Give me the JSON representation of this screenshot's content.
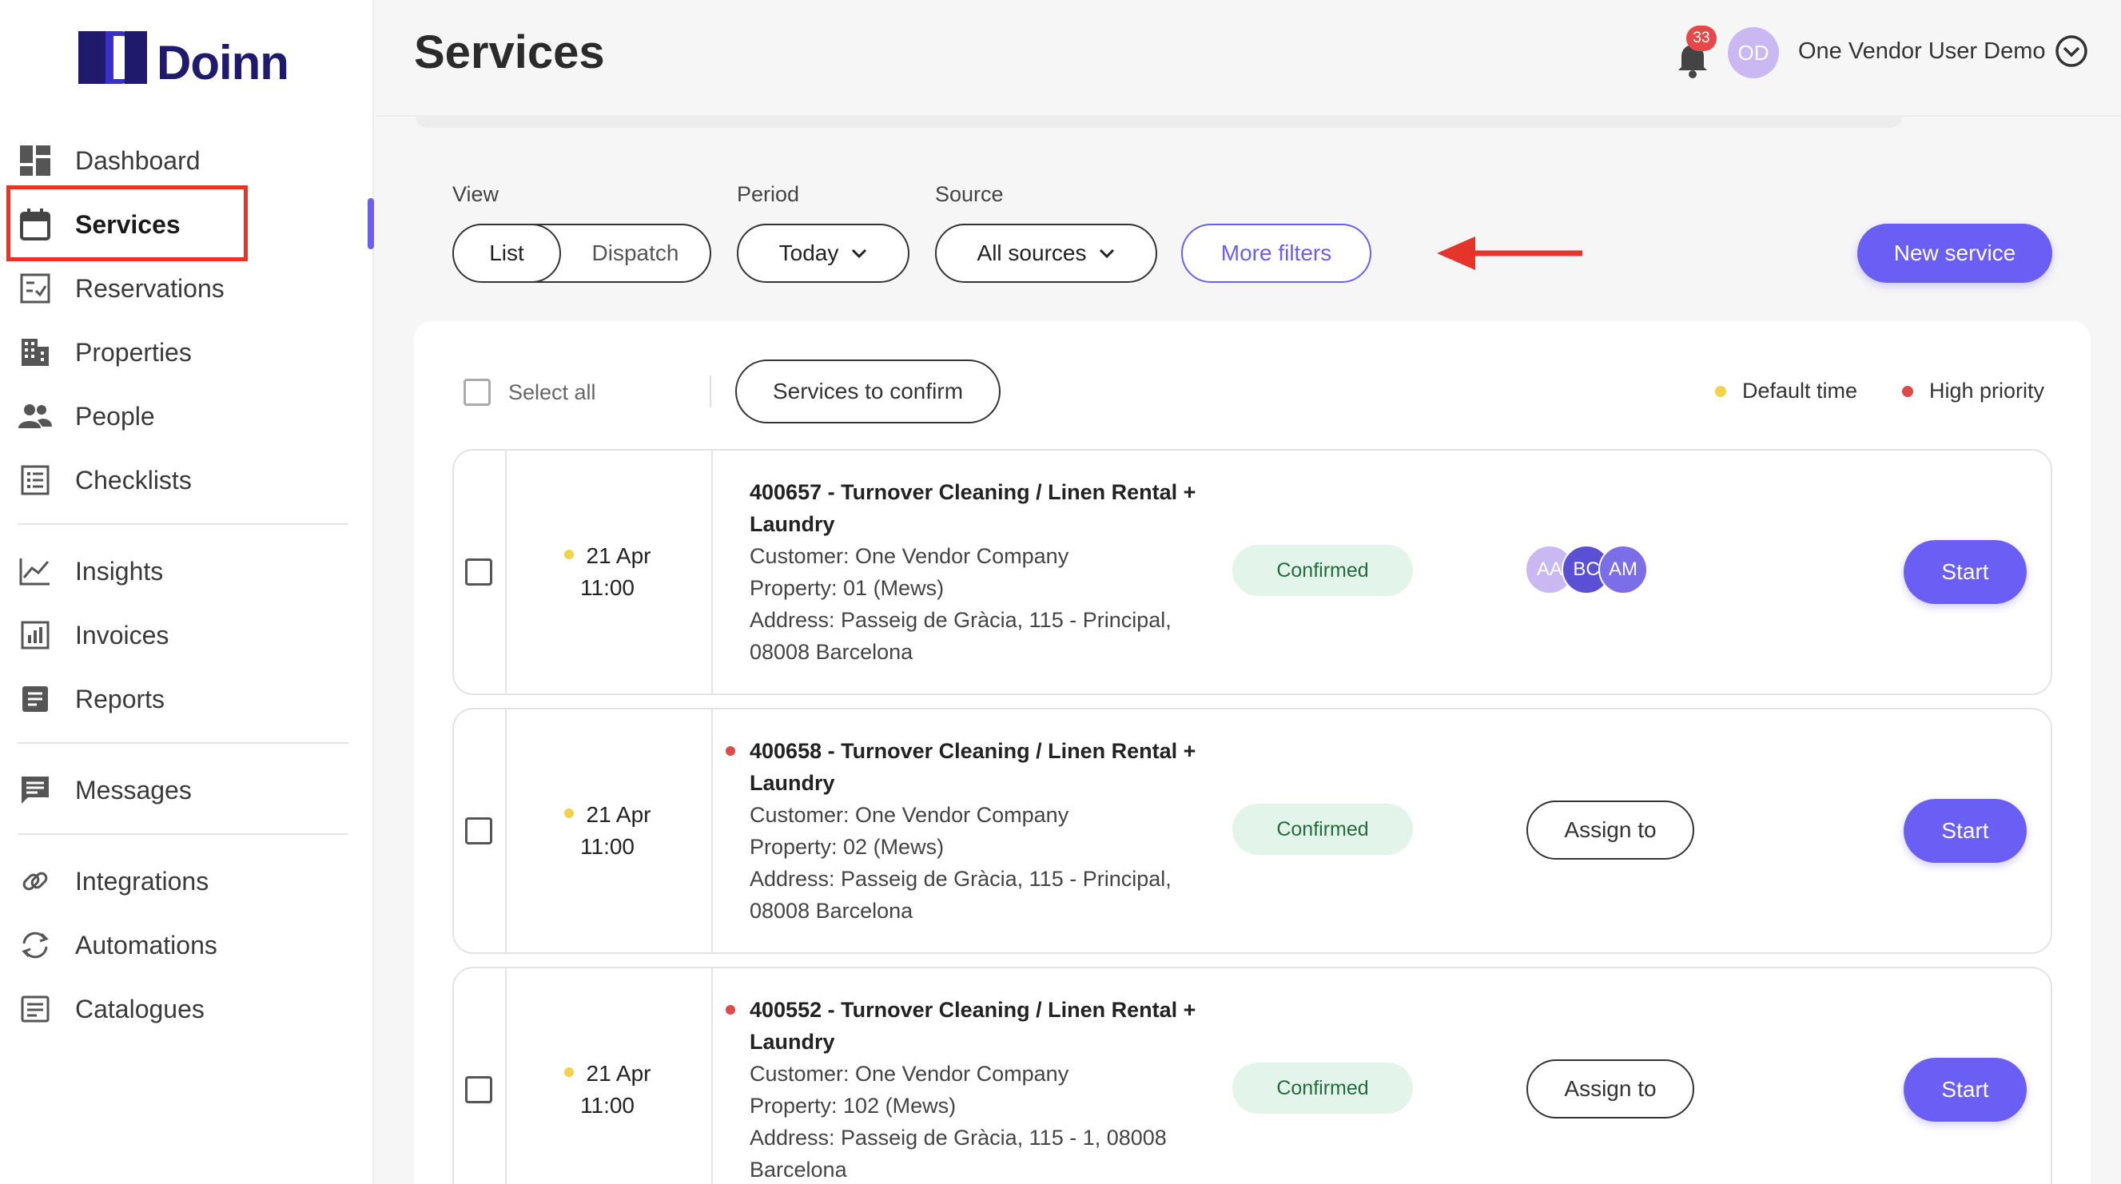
{
  "brand": {
    "name": "Doinn",
    "color": "#1f1a6b",
    "accent": "#6b5ef5"
  },
  "sidebar": {
    "items": [
      {
        "label": "Dashboard",
        "icon": "dashboard-icon"
      },
      {
        "label": "Services",
        "icon": "calendar-icon",
        "active": true
      },
      {
        "label": "Reservations",
        "icon": "reservation-check-icon"
      },
      {
        "label": "Properties",
        "icon": "building-icon"
      },
      {
        "label": "People",
        "icon": "people-icon"
      },
      {
        "label": "Checklists",
        "icon": "checklist-icon"
      },
      {
        "label": "Insights",
        "icon": "line-chart-icon"
      },
      {
        "label": "Invoices",
        "icon": "invoice-chart-icon"
      },
      {
        "label": "Reports",
        "icon": "report-icon"
      },
      {
        "label": "Messages",
        "icon": "message-icon"
      },
      {
        "label": "Integrations",
        "icon": "link-icon"
      },
      {
        "label": "Automations",
        "icon": "sync-icon"
      },
      {
        "label": "Catalogues",
        "icon": "catalogue-icon"
      }
    ]
  },
  "header": {
    "title": "Services",
    "notifications_count": "33",
    "user_initials": "OD",
    "user_name": "One Vendor User Demo"
  },
  "filters": {
    "view_label": "View",
    "view_options": [
      "List",
      "Dispatch"
    ],
    "view_selected": "List",
    "period_label": "Period",
    "period_value": "Today",
    "source_label": "Source",
    "source_value": "All sources",
    "more_filters": "More filters",
    "new_service": "New service"
  },
  "toolbar": {
    "select_all": "Select all",
    "services_to_confirm": "Services to confirm",
    "legend_default": "Default time",
    "legend_priority": "High priority",
    "legend_default_color": "#f2d24b",
    "legend_priority_color": "#e04a4a"
  },
  "services": [
    {
      "date": "21 Apr",
      "time": "11:00",
      "title": "400657 - Turnover Cleaning / Linen Rental + Laundry",
      "customer": "Customer: One Vendor Company",
      "property": "Property: 01 (Mews)",
      "address": "Address: Passeig de Gràcia, 115 - Principal, 08008 Barcelona",
      "status": "Confirmed",
      "high_priority": false,
      "assignees": [
        "AA",
        "BC",
        "AM"
      ],
      "start": "Start"
    },
    {
      "date": "21 Apr",
      "time": "11:00",
      "title": "400658 - Turnover Cleaning / Linen Rental + Laundry",
      "customer": "Customer: One Vendor Company",
      "property": "Property: 02 (Mews)",
      "address": "Address: Passeig de Gràcia, 115 - Principal, 08008 Barcelona",
      "status": "Confirmed",
      "high_priority": true,
      "assign_label": "Assign to",
      "start": "Start"
    },
    {
      "date": "21 Apr",
      "time": "11:00",
      "title": "400552 - Turnover Cleaning / Linen Rental + Laundry",
      "customer": "Customer: One Vendor Company",
      "property": "Property: 102 (Mews)",
      "address": "Address: Passeig de Gràcia, 115 - 1, 08008 Barcelona",
      "status": "Confirmed",
      "high_priority": true,
      "assign_label": "Assign to",
      "start": "Start"
    }
  ]
}
